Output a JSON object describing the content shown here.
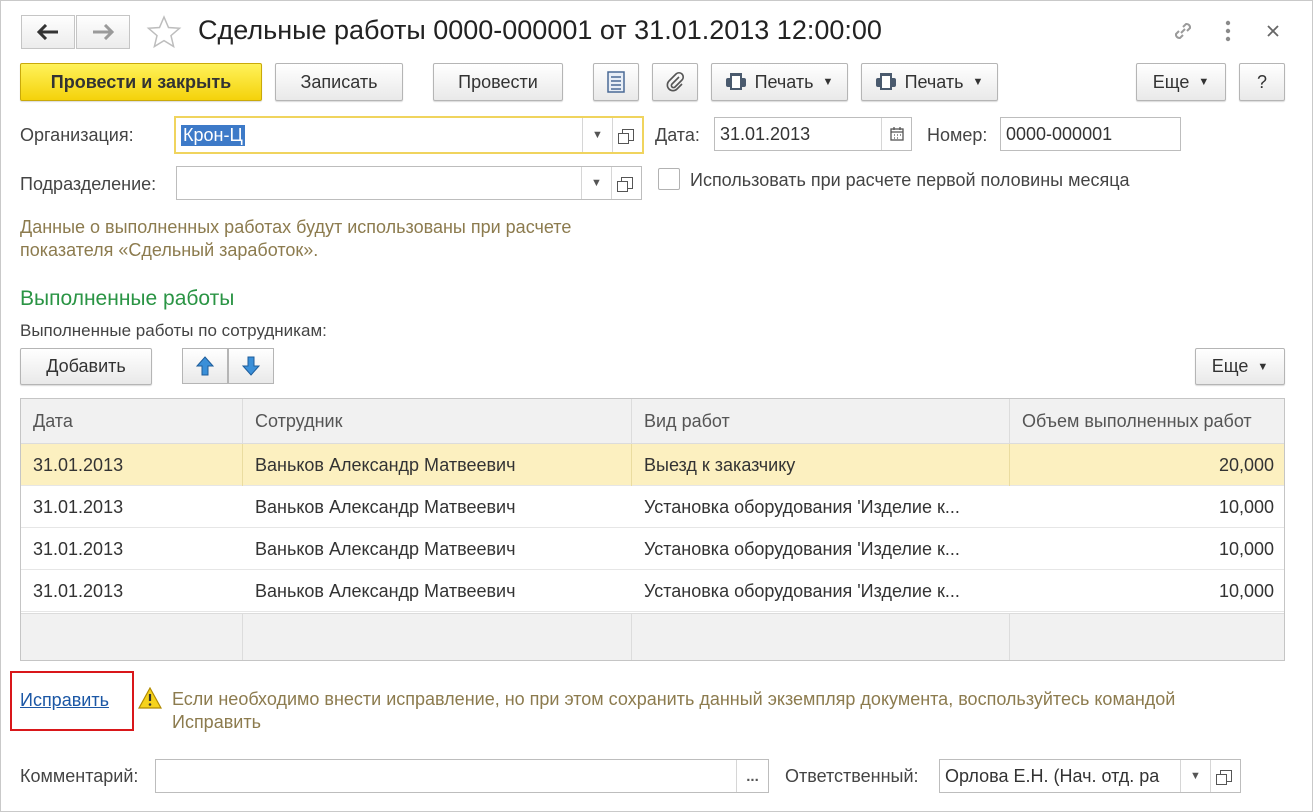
{
  "window": {
    "title": "Сдельные работы 0000-000001 от 31.01.2013 12:00:00"
  },
  "toolbar": {
    "post_close": "Провести и закрыть",
    "save": "Записать",
    "post": "Провести",
    "print1": "Печать",
    "print2": "Печать",
    "more": "Еще",
    "help": "?"
  },
  "form": {
    "org_label": "Организация:",
    "org_value": "Крон-Ц",
    "date_label": "Дата:",
    "date_value": "31.01.2013",
    "number_label": "Номер:",
    "number_value": "0000-000001",
    "dept_label": "Подразделение:",
    "dept_value": "",
    "half_month_label": "Использовать при расчете первой половины месяца",
    "info_line1": "Данные о выполненных работах будут использованы при расчете",
    "info_line2": "показателя «Сдельный заработок»."
  },
  "works": {
    "section_title": "Выполненные работы",
    "subtitle": "Выполненные работы по сотрудникам:",
    "add": "Добавить",
    "more": "Еще",
    "columns": [
      "Дата",
      "Сотрудник",
      "Вид работ",
      "Объем выполненных работ"
    ],
    "rows": [
      [
        "31.01.2013",
        "Ваньков Александр Матвеевич",
        "Выезд к заказчику",
        "20,000"
      ],
      [
        "31.01.2013",
        "Ваньков Александр Матвеевич",
        "Установка оборудования 'Изделие к...",
        "10,000"
      ],
      [
        "31.01.2013",
        "Ваньков Александр Матвеевич",
        "Установка оборудования 'Изделие к...",
        "10,000"
      ],
      [
        "31.01.2013",
        "Ваньков Александр Матвеевич",
        "Установка оборудования 'Изделие к...",
        "10,000"
      ]
    ]
  },
  "correction": {
    "link": "Исправить",
    "message_line1": "Если необходимо внести исправление, но при этом сохранить данный экземпляр документа, воспользуйтесь командой",
    "message_line2": "Исправить"
  },
  "footer": {
    "comment_label": "Комментарий:",
    "comment_value": "",
    "comment_more": "...",
    "responsible_label": "Ответственный:",
    "responsible_value": "Орлова Е.Н. (Нач. отд. ра"
  },
  "colors": {
    "primary_button": "#f4d20b",
    "section_title": "#2a9444",
    "hint_text": "#8c7b4e",
    "selected_row": "#fcf0c0",
    "link": "#1b57a5",
    "highlight_box": "#d9171a"
  }
}
